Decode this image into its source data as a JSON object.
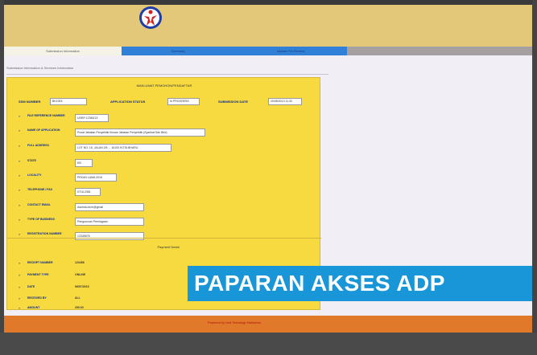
{
  "tabs": [
    {
      "label": "Submission Information"
    },
    {
      "label": "Summary"
    },
    {
      "label": "Update For Review"
    }
  ],
  "subheading": "Submission Information & Services Information",
  "panel": {
    "title": "MAKLUMAT PEMOHON/PENDAFTAR",
    "header": {
      "ssm_number_label": "SSM NUMBER",
      "ssm_number_value": "BK1003",
      "app_status_label": "APPLICATION STATUS",
      "app_status_value": "In PROGRESS",
      "submission_date_label": "SUBMISSION DATE",
      "submission_date_value": "20/08/2013 11:32"
    },
    "rows": [
      {
        "label": "FILE REFERENCE NUMBER",
        "value": "USER 12345/13"
      },
      {
        "label": "NAME OF APPLICATION",
        "value": "Pusat Jabatan Penyelidik Ilmuan Jabatan Penyelidik (Syarikat Sdn Bhd)"
      },
      {
        "label": "FULL ADDRESS",
        "value": "LOT NO. 16, JALAN 2/5 ... 16100 KOTA BHARU"
      },
      {
        "label": "STATE",
        "value": "KB"
      },
      {
        "label": "LOCALITY",
        "value": "PEKAN LAMA 2016"
      },
      {
        "label": "TELEPHONE / FAX",
        "value": "0716-2361"
      },
      {
        "label": "CONTACT EMAIL",
        "value": "Asensio.tech@gmail"
      },
      {
        "label": "TYPE OF BUSINESS",
        "value": "Pengurusan Perniagaan"
      },
      {
        "label": "REGISTRATION NUMBER",
        "value": "12345678"
      }
    ],
    "section_title": "Payment Detail",
    "payment_rows": [
      {
        "label": "RECEIPT NUMBER",
        "value": "123456"
      },
      {
        "label": "PAYMENT TYPE",
        "value": "ONLINE"
      },
      {
        "label": "DATE",
        "value": "06/07/2015"
      },
      {
        "label": "RECEIVED BY",
        "value": "ALL"
      },
      {
        "label": "AMOUNT",
        "value": "250.00"
      }
    ]
  },
  "footer": {
    "text": "Powered by Unit Teknologi Maklumat"
  },
  "overlay": {
    "text": "PAPARAN AKSES ADP"
  },
  "colors": {
    "banner": "#e3c879",
    "tab_active": "#2f80d6",
    "panel": "#f7d940",
    "footer": "#e07a2a",
    "overlay": "#1896d8"
  }
}
